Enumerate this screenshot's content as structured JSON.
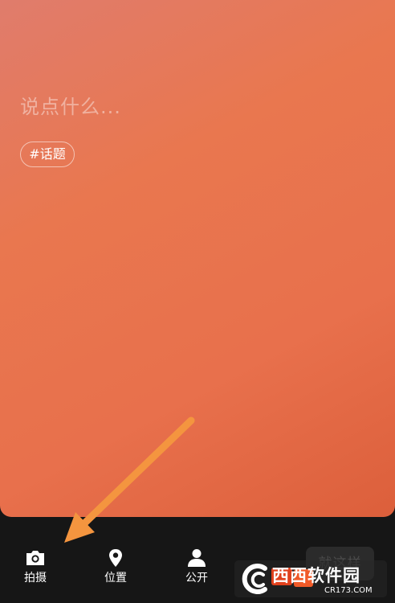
{
  "compose": {
    "placeholder": "说点什么...",
    "topic_chip": "#话题",
    "background_colors": [
      "#e07c6c",
      "#e9774f",
      "#dc5f3b"
    ]
  },
  "bottom_bar": {
    "items": [
      {
        "label": "拍摄",
        "icon": "camera-icon"
      },
      {
        "label": "位置",
        "icon": "location-pin-icon"
      },
      {
        "label": "公开",
        "icon": "person-icon"
      }
    ],
    "send_label": "就这样"
  },
  "annotation": {
    "arrow_color": "#f4953f",
    "arrow_target": "拍摄"
  },
  "watermark": {
    "brand": "西西软件园",
    "site": "CR173.COM"
  }
}
